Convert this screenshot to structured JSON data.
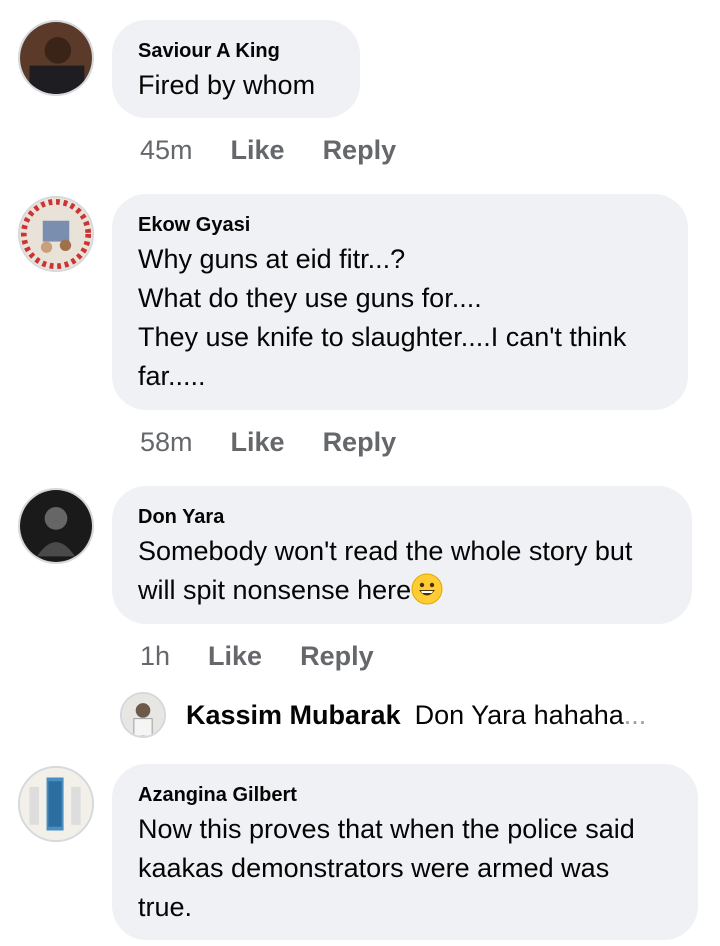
{
  "comments": [
    {
      "author": "Saviour A King",
      "lines": [
        "Fired by whom"
      ],
      "time": "45m",
      "like": "Like",
      "reply": "Reply"
    },
    {
      "author": "Ekow Gyasi",
      "lines": [
        "Why guns at eid fitr...?",
        "What do they use guns for....",
        "They use knife to slaughter....I can't think",
        "far....."
      ],
      "time": "58m",
      "like": "Like",
      "reply": "Reply"
    },
    {
      "author": "Don Yara",
      "lines": [
        "Somebody won't read the whole story but",
        "will spit nonsense here"
      ],
      "emoji": "grinning-face-emoji",
      "time": "1h",
      "like": "Like",
      "reply": "Reply"
    },
    {
      "author": "Azangina Gilbert",
      "lines": [
        "Now this proves that when the police said",
        "kaakas demonstrators were armed was",
        "true."
      ]
    }
  ],
  "reply_preview": {
    "author": "Kassim Mubarak",
    "text": "Don Yara hahaha",
    "ellipsis": "..."
  },
  "colors": {
    "bubble": "#eff1f4",
    "meta": "#65676b",
    "text": "#050505"
  }
}
